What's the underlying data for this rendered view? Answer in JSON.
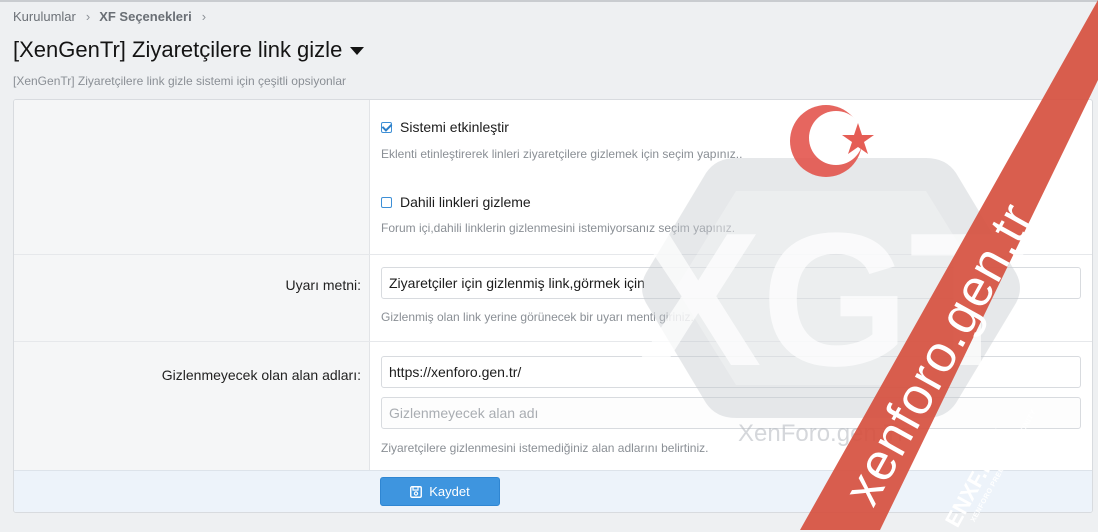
{
  "breadcrumb": {
    "items": [
      "Kurulumlar",
      "XF Seçenekleri"
    ],
    "separator": "›"
  },
  "page": {
    "title": "[XenGenTr] Ziyaretçilere link gizle",
    "description": "[XenGenTr] Ziyaretçilere link gizle sistemi için çeşitli opsiyonlar"
  },
  "options": {
    "enable": {
      "label": "Sistemi etkinleştir",
      "checked": true,
      "hint": "Eklenti etinleştirerek linleri ziyaretçilere gizlemek için seçim yapınız.."
    },
    "internal": {
      "label": "Dahili linkleri gizleme",
      "checked": false,
      "hint": "Forum içi,dahili linklerin gizlenmesini istemiyorsanız seçim yapınız."
    },
    "warning": {
      "label": "Uyarı metni:",
      "value": "Ziyaretçiler için gizlenmiş link,görmek için",
      "hint": "Gizlenmiş olan link yerine görünecek bir uyarı menti giriniz."
    },
    "domains": {
      "label": "Gizlenmeyecek olan alan adları:",
      "value": "https://xenforo.gen.tr/",
      "placeholder": "Gizlenmeyecek alan adı",
      "hint": "Ziyaretçilere gizlenmesini istemediğiniz alan adlarını belirtiniz."
    }
  },
  "footer": {
    "save_label": "Kaydet"
  },
  "watermark": {
    "logo_text": "XGT",
    "logo_caption": "XenForo.gen.Tr",
    "diagonal_text": "xenforo.gen.tr",
    "badge_text": "ENXF.NET",
    "badge_subtext": "XENFORO PREMIUM COMMUNITY"
  },
  "colors": {
    "accent": "#3e95df",
    "checkbox": "#3d8fd6",
    "watermark_red": "#d14b3d",
    "hint_text": "#8a8f95"
  }
}
